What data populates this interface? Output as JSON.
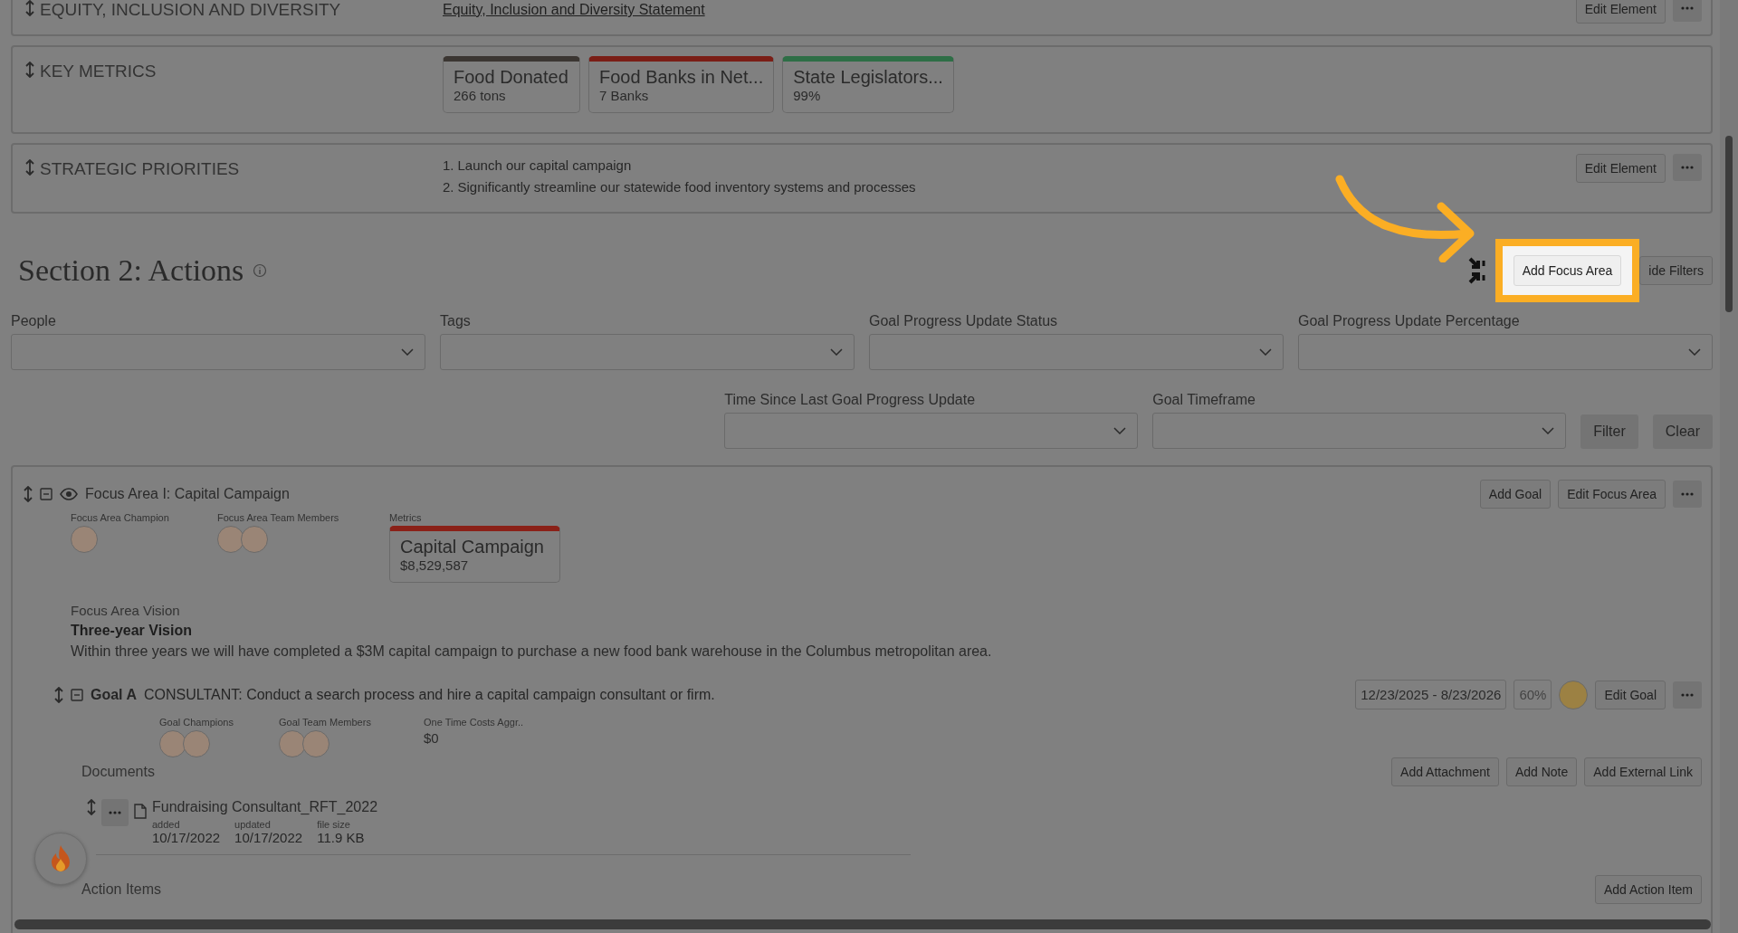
{
  "strategy_elements": [
    {
      "kind": "link",
      "title": "EQUITY, INCLUSION AND DIVERSITY",
      "link": "Equity, Inclusion and Diversity Statement",
      "button": "Edit Element"
    },
    {
      "kind": "metrics",
      "title": "KEY METRICS",
      "metrics": [
        {
          "name": "Food Donated",
          "value": "266 tons",
          "color": "#3b3632"
        },
        {
          "name": "Food Banks in Net...",
          "value": "7 Banks",
          "color": "#7a1e16"
        },
        {
          "name": "State Legislators...",
          "value": "99%",
          "color": "#2e6e46"
        }
      ]
    },
    {
      "kind": "list",
      "title": "STRATEGIC PRIORITIES",
      "items": [
        {
          "marker": "1.",
          "text": "Launch our capital campaign"
        },
        {
          "marker": "2.",
          "text": "Significantly streamline our statewide food inventory systems and processes"
        }
      ],
      "button": "Edit Element"
    }
  ],
  "section": {
    "title": "Section 2: Actions",
    "highlighted_button": "Add Focus Area",
    "button": "ide Filters"
  },
  "filters": [
    {
      "label": "People"
    },
    {
      "label": "Tags"
    },
    {
      "label": "Goal Progress Update Status"
    },
    {
      "label": "Goal Progress Update Percentage"
    }
  ],
  "filters_row_2": [
    {
      "label": "Time Since Last Goal Progress Update"
    },
    {
      "label": "Goal Timeframe"
    }
  ],
  "filter_buttons": [
    "Filter",
    "Clear"
  ],
  "focus_area": {
    "title": "Focus Area I: Capital Campaign",
    "buttons": [
      "Add Goal",
      "Edit Focus Area"
    ],
    "champion_label": "Focus Area Champion",
    "champions": [
      {
        "kind": "person"
      }
    ],
    "team_label": "Focus Area Team Members",
    "team": [
      {
        "kind": "person"
      },
      {
        "kind": "person"
      }
    ],
    "metrics_label": "Metrics",
    "metric": {
      "name": "Capital Campaign",
      "value": "$8,529,587",
      "color": "#8a2118"
    },
    "vision_label": "Focus Area Vision",
    "vision_title": "Three-year Vision",
    "vision_text": "Within three years we will have completed a $3M capital campaign to purchase a new food bank warehouse in the Columbus metropolitan area.",
    "goal": {
      "label": "Goal A",
      "text": "CONSULTANT: Conduct a search process and hire a capital campaign consultant or firm.",
      "timeframe": "12/23/2025 - 8/23/2026",
      "percent": "60%",
      "color": "#9c8143",
      "button": "Edit Goal",
      "champions_label": "Goal Champions",
      "champions": [
        {
          "kind": "person"
        },
        {
          "kind": "person"
        }
      ],
      "team_label": "Goal Team Members",
      "team": [
        {
          "kind": "person"
        },
        {
          "kind": "person"
        }
      ],
      "costs_label": "One Time Costs Aggr..",
      "costs": "$0",
      "documents_label": "Documents",
      "document_buttons": [
        "Add Attachment",
        "Add Note",
        "Add External Link"
      ],
      "documents": [
        {
          "name": "Fundraising Consultant_RFT_2022",
          "added_label": "added",
          "added": "10/17/2022",
          "updated_label": "updated",
          "updated": "10/17/2022",
          "size_label": "file size",
          "size": "11.9 KB"
        }
      ],
      "action_items_label": "Action Items",
      "action_button": "Add Action Item"
    }
  }
}
